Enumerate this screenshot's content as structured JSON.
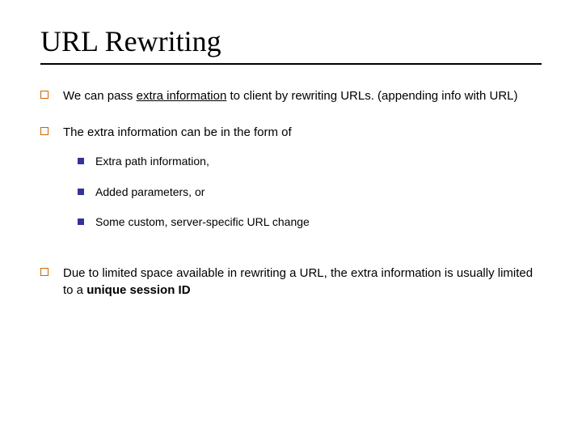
{
  "title": "URL Rewriting",
  "bullets": {
    "b1_part1": "We can pass ",
    "b1_underlined": "extra information",
    "b1_part2": "  to client by rewriting URLs. (appending info with URL)",
    "b2": "The extra information can be in the form of",
    "b2_sub1": "Extra path information,",
    "b2_sub2": "Added parameters, or",
    "b2_sub3": "Some custom, server-specific URL change",
    "b3_part1": "Due to limited space available in rewriting a URL, the extra information is usually limited to a ",
    "b3_bold": "unique session ID"
  }
}
